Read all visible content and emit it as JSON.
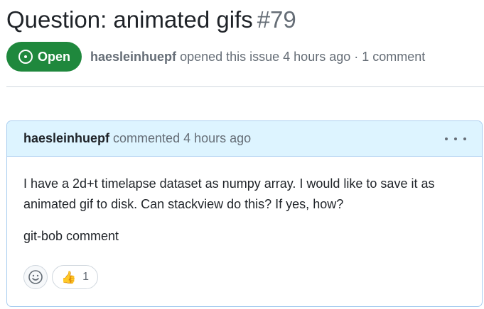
{
  "issue": {
    "title": "Question: animated gifs",
    "number": "#79",
    "state": "Open",
    "author": "haesleinhuepf",
    "meta_text": "opened this issue 4 hours ago · 1 comment"
  },
  "comment": {
    "author": "haesleinhuepf",
    "meta_text": "commented 4 hours ago",
    "paragraphs": [
      "I have a 2d+t timelapse dataset as numpy array. I would like to save it as animated gif to disk. Can stackview do this? If yes, how?",
      "git-bob comment"
    ],
    "reactions": [
      {
        "emoji": "👍",
        "count": "1"
      }
    ]
  },
  "colors": {
    "open_badge": "#1f883d",
    "comment_header_bg": "#ddf4ff",
    "comment_border": "#a8cdf0"
  }
}
